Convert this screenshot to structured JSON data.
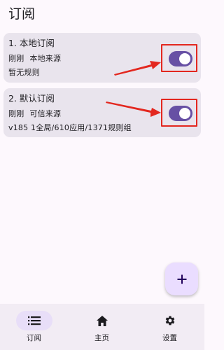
{
  "header": {
    "title": "订阅"
  },
  "subscriptions": [
    {
      "title": "1. 本地订阅",
      "meta": [
        "刚刚",
        "本地来源"
      ],
      "detail": "暂无规则",
      "enabled": true
    },
    {
      "title": "2. 默认订阅",
      "meta": [
        "刚刚",
        "可信来源"
      ],
      "detail": "v185   1全局/610应用/1371规则组",
      "enabled": true
    }
  ],
  "fab": {
    "icon": "plus-icon"
  },
  "bottom_nav": {
    "items": [
      {
        "label": "订阅",
        "icon": "list-icon",
        "active": true
      },
      {
        "label": "主页",
        "icon": "home-icon",
        "active": false
      },
      {
        "label": "设置",
        "icon": "gear-icon",
        "active": false
      }
    ]
  },
  "colors": {
    "accent": "#6750a4",
    "card": "#e9e4ed",
    "highlight": "#e3271f",
    "fab": "#eaddff",
    "nav_pill": "#e8def8"
  }
}
